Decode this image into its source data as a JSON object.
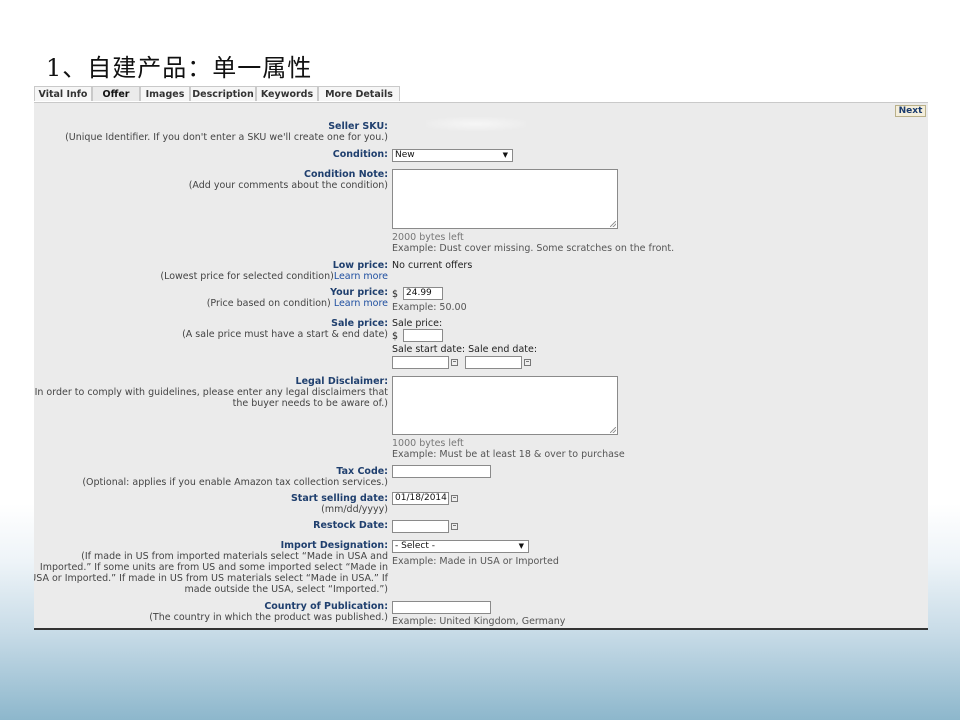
{
  "slide_title": "1、自建产品：单一属性",
  "tabs": [
    "Vital Info",
    "Offer",
    "Images",
    "Description",
    "Keywords",
    "More Details"
  ],
  "next_label": "Next",
  "sku": {
    "label": "Seller SKU:",
    "help": "(Unique Identifier. If you don't enter a SKU we'll create one for you.)"
  },
  "condition": {
    "label": "Condition:",
    "value": "New"
  },
  "condition_note": {
    "label": "Condition Note:",
    "help": "(Add your comments about the condition)",
    "bytes_left": "2000 bytes left",
    "example": "Example: Dust cover missing. Some scratches on the front."
  },
  "low_price": {
    "label": "Low price:",
    "help": "(Lowest price for selected condition)",
    "link": "Learn more",
    "value": "No current offers"
  },
  "your_price": {
    "label": "Your price:",
    "help": "(Price based on condition)",
    "link": "Learn more",
    "currency": "$",
    "value": "24.99",
    "example": "Example: 50.00"
  },
  "sale_price": {
    "label": "Sale price:",
    "help": "(A sale price must have a start & end date)",
    "sub_label": "Sale price:",
    "currency": "$",
    "start_label": "Sale start date:",
    "end_label": "Sale end date:"
  },
  "legal": {
    "label": "Legal Disclaimer:",
    "help": "(In order to comply with guidelines, please enter any legal disclaimers that the buyer needs to be aware of.)",
    "bytes_left": "1000 bytes left",
    "example": "Example: Must be at least 18 & over to purchase"
  },
  "tax_code": {
    "label": "Tax Code:",
    "help": "(Optional: applies if you enable Amazon tax collection services.)"
  },
  "start_selling": {
    "label": "Start selling date:",
    "help": "(mm/dd/yyyy)",
    "value": "01/18/2014"
  },
  "restock": {
    "label": "Restock Date:"
  },
  "import": {
    "label": "Import Designation:",
    "help": "(If made in US from imported materials select “Made in USA and Imported.” If some units are from US and some imported select “Made in USA or Imported.” If made in US from US materials select “Made in USA.” If made outside the USA, select “Imported.”)",
    "value": "- Select -",
    "example": "Example: Made in USA or Imported"
  },
  "country": {
    "label": "Country of Publication:",
    "help": "(The country in which the product was published.)",
    "example": "Example: United Kingdom, Germany"
  }
}
